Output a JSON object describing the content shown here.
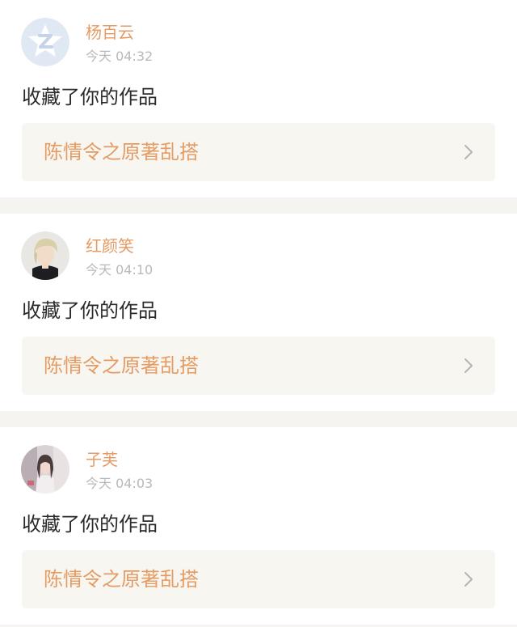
{
  "notifications": [
    {
      "username": "杨百云",
      "time": "今天 04:32",
      "action": "收藏了你的作品",
      "work_title": "陈情令之原著乱搭",
      "avatar": "default-z-logo-avatar"
    },
    {
      "username": "红颜笑",
      "time": "今天 04:10",
      "action": "收藏了你的作品",
      "work_title": "陈情令之原著乱搭",
      "avatar": "photo-avatar-blond-man"
    },
    {
      "username": "子芙",
      "time": "今天 04:03",
      "action": "收藏了你的作品",
      "work_title": "陈情令之原著乱搭",
      "avatar": "photo-avatar-girl"
    }
  ],
  "colors": {
    "accent": "#e59b63",
    "time": "#b9b9b9",
    "card_bg": "#f7f6f1",
    "divider": "#f5f4f1"
  }
}
